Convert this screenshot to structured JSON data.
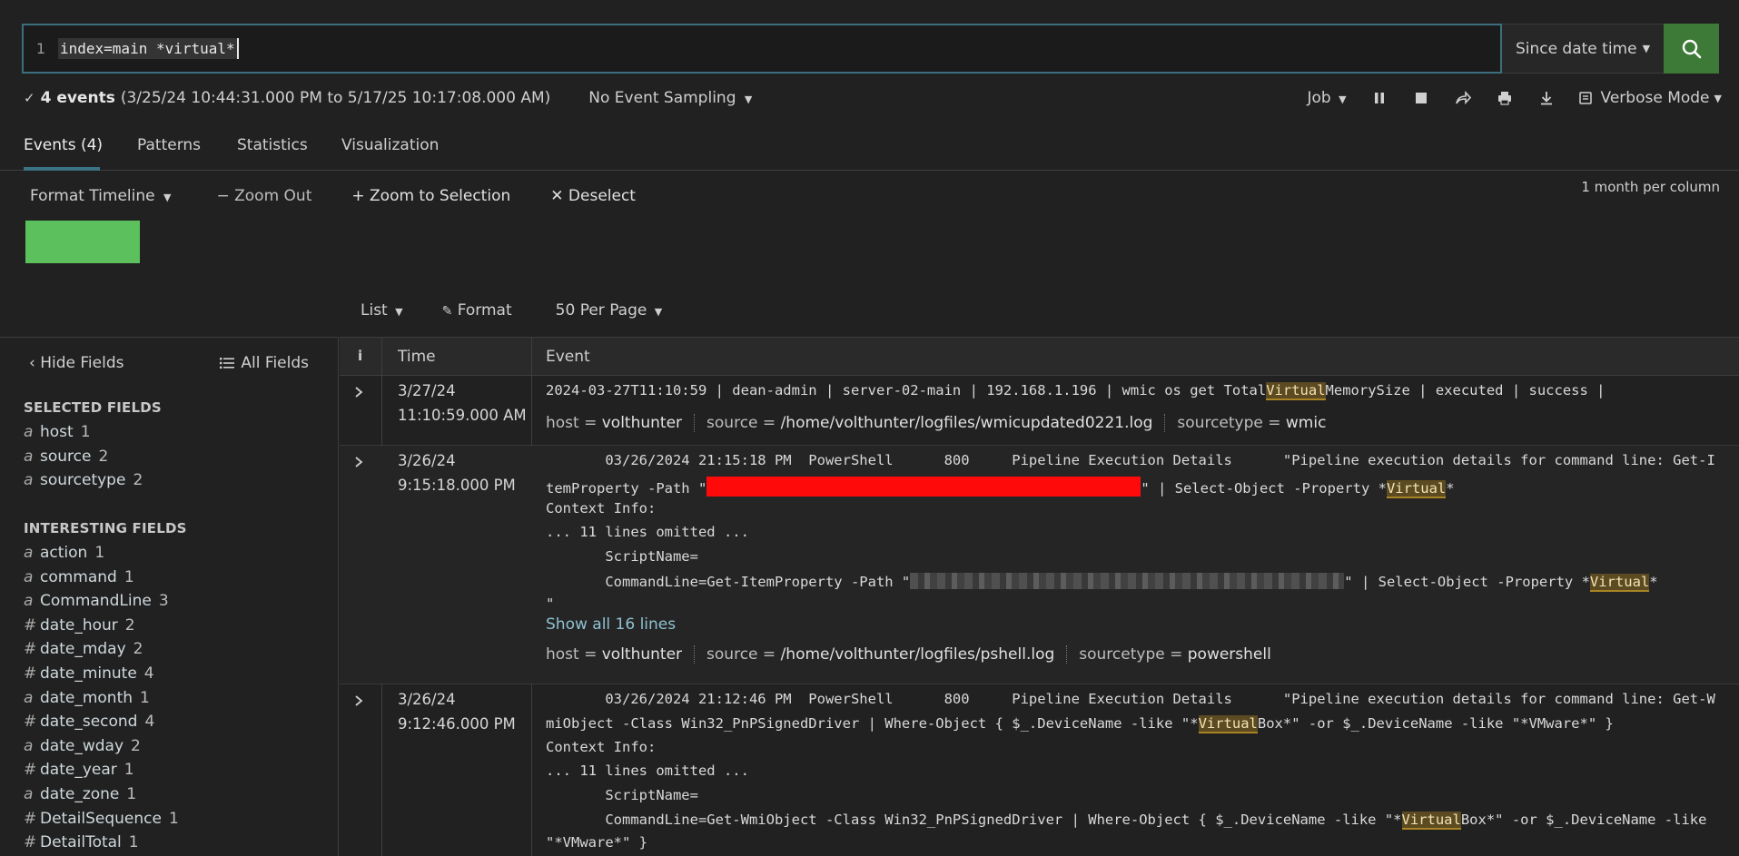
{
  "search": {
    "line_number": "1",
    "query": "index=main *virtual*",
    "time_range": "Since date time",
    "search_icon": "search-icon"
  },
  "status": {
    "event_count": "4 events",
    "range": "(3/25/24 10:44:31.000 PM to 5/17/25 10:17:08.000 AM)",
    "sampling": "No Event Sampling",
    "job": "Job",
    "mode": "Verbose Mode"
  },
  "tabs": [
    {
      "label": "Events (4)"
    },
    {
      "label": "Patterns"
    },
    {
      "label": "Statistics"
    },
    {
      "label": "Visualization"
    }
  ],
  "timeline": {
    "format": "Format Timeline",
    "zoom_out": "Zoom Out",
    "zoom_selection": "Zoom to Selection",
    "deselect": "Deselect",
    "scale": "1 month per column",
    "bar_color": "#5cc15c"
  },
  "list_controls": {
    "list": "List",
    "format": "Format",
    "per_page": "50 Per Page"
  },
  "sidebar": {
    "hide_fields": "Hide Fields",
    "all_fields": "All Fields",
    "selected_header": "SELECTED FIELDS",
    "selected": [
      {
        "type": "a",
        "name": "host",
        "count": "1"
      },
      {
        "type": "a",
        "name": "source",
        "count": "2"
      },
      {
        "type": "a",
        "name": "sourcetype",
        "count": "2"
      }
    ],
    "interesting_header": "INTERESTING FIELDS",
    "interesting": [
      {
        "type": "a",
        "name": "action",
        "count": "1"
      },
      {
        "type": "a",
        "name": "command",
        "count": "1"
      },
      {
        "type": "a",
        "name": "CommandLine",
        "count": "3"
      },
      {
        "type": "#",
        "name": "date_hour",
        "count": "2"
      },
      {
        "type": "#",
        "name": "date_mday",
        "count": "2"
      },
      {
        "type": "#",
        "name": "date_minute",
        "count": "4"
      },
      {
        "type": "a",
        "name": "date_month",
        "count": "1"
      },
      {
        "type": "#",
        "name": "date_second",
        "count": "4"
      },
      {
        "type": "a",
        "name": "date_wday",
        "count": "2"
      },
      {
        "type": "#",
        "name": "date_year",
        "count": "1"
      },
      {
        "type": "a",
        "name": "date_zone",
        "count": "1"
      },
      {
        "type": "#",
        "name": "DetailSequence",
        "count": "1"
      },
      {
        "type": "#",
        "name": "DetailTotal",
        "count": "1"
      }
    ]
  },
  "table": {
    "headers": {
      "info": "i",
      "time": "Time",
      "event": "Event"
    },
    "events": [
      {
        "date": "3/27/24",
        "time": "11:10:59.000 AM",
        "line1_pre": "2024-03-27T11:10:59 | dean-admin | server-02-main | 192.168.1.196 | wmic os get Total",
        "line1_hl": "Virtual",
        "line1_post": "MemorySize | executed | success |",
        "host": "volthunter",
        "source": "/home/volthunter/logfiles/wmicupdated0221.log",
        "sourcetype": "wmic"
      },
      {
        "date": "3/26/24",
        "time": "9:15:18.000 PM",
        "l1": "       03/26/2024 21:15:18 PM  PowerShell      800     Pipeline Execution Details      \"Pipeline execution details for command line: Get-I",
        "l2_pre": "temProperty -Path \"",
        "l2_mid": "\" | Select-Object -Property *",
        "l2_hl": "Virtual",
        "l2_post": "*",
        "l3": "Context Info:",
        "l4": "... 11 lines omitted ...",
        "l5": "       ScriptName=",
        "l6_pre": "       CommandLine=Get-ItemProperty -Path \"",
        "l6_mid": "\" | Select-Object -Property *",
        "l6_hl": "Virtual",
        "l6_post": "*",
        "l7": "\"",
        "show_all": "Show all 16 lines",
        "host": "volthunter",
        "source": "/home/volthunter/logfiles/pshell.log",
        "sourcetype": "powershell"
      },
      {
        "date": "3/26/24",
        "time": "9:12:46.000 PM",
        "l1": "       03/26/2024 21:12:46 PM  PowerShell      800     Pipeline Execution Details      \"Pipeline execution details for command line: Get-W",
        "l2_pre": "miObject -Class Win32_PnPSignedDriver | Where-Object { $_.DeviceName -like \"*",
        "l2_hl": "Virtual",
        "l2_post": "Box*\" -or $_.DeviceName -like \"*VMware*\" }",
        "l3": "Context Info:",
        "l4": "... 11 lines omitted ...",
        "l5": "       ScriptName=",
        "l6_pre": "       CommandLine=Get-WmiObject -Class Win32_PnPSignedDriver | Where-Object { $_.DeviceName -like \"*",
        "l6_hl": "Virtual",
        "l6_post": "Box*\" -or $_.DeviceName -like",
        "l7": "\"*VMware*\" }"
      }
    ],
    "meta_labels": {
      "host": "host = ",
      "source": "source = ",
      "sourcetype": "sourcetype = "
    }
  }
}
